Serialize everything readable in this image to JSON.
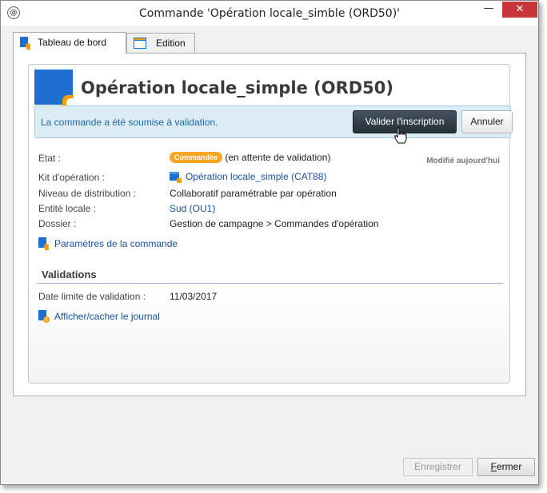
{
  "window": {
    "title": "Commande 'Opération locale_simble (ORD50)'",
    "app_icon": "@",
    "minimize_glyph": "—",
    "close_glyph": "✕"
  },
  "tabs": [
    {
      "label": "Tableau de bord",
      "icon": "dashboard-icon",
      "active": true
    },
    {
      "label": "Edition",
      "icon": "edit-window-icon",
      "active": false
    }
  ],
  "header": {
    "title": "Opération locale_simple (ORD50)"
  },
  "banner": {
    "message": "La commande a été soumise à validation.",
    "validate_label": "Valider l'inscription",
    "cancel_label": "Annuler"
  },
  "details": {
    "modified": "Modifié aujourd'hui",
    "fields": [
      {
        "label": "Etat :",
        "badge": "Commandée",
        "value": "(en attente de validation)"
      },
      {
        "label": "Kit d'opération :",
        "value": "Opération locale_simple (CAT88)",
        "link": true
      },
      {
        "label": "Niveau de distribution :",
        "value": "Collaboratif paramétrable par opération"
      },
      {
        "label": "Entité locale :",
        "value": "Sud (OU1)",
        "link": true
      },
      {
        "label": "Dossier :",
        "value": "Gestion de campagne > Commandes d'opération"
      }
    ],
    "params_link": "Paramètres de la commande"
  },
  "validations": {
    "title": "Validations",
    "deadline_label": "Date limite de validation :",
    "deadline_value": "11/03/2017",
    "journal_link": "Afficher/cacher le journal"
  },
  "footer": {
    "save_label": "Enregistrer",
    "close_label_first": "F",
    "close_label_rest": "ermer"
  },
  "colors": {
    "accent_blue": "#1f6fd1",
    "badge_orange": "#f6a623",
    "banner_bg": "#dcecf4",
    "link": "#1a4f9c"
  }
}
